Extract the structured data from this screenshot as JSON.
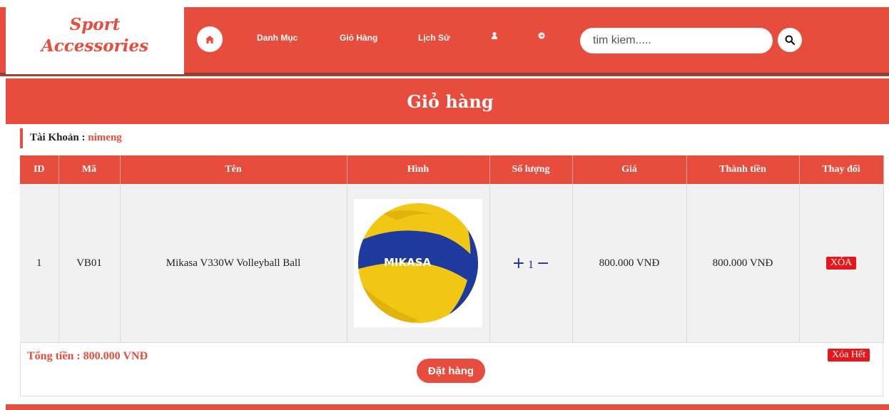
{
  "brand": {
    "line1": "Sport",
    "line2": "Accessories",
    "color": "#e74c3c"
  },
  "nav": {
    "home_icon": "home-icon",
    "items": [
      {
        "label": "Danh Mục"
      },
      {
        "label": "Giỏ Hàng"
      },
      {
        "label": "Lịch Sử"
      }
    ],
    "user_icon": "user-icon",
    "logout_icon": "sign-out-icon"
  },
  "search": {
    "placeholder": "tim kiem.....",
    "icon": "search-icon"
  },
  "page_title": "Giỏ hàng",
  "account": {
    "label": "Tài Khoản :",
    "username": "nimeng"
  },
  "table": {
    "headers": [
      "ID",
      "Mã",
      "Tên",
      "Hình",
      "Số lượng",
      "Giá",
      "Thành tiền",
      "Thay đổi"
    ],
    "rows": [
      {
        "id": "1",
        "code": "VB01",
        "name": "Mikasa V330W Volleyball Ball",
        "image": "volleyball-image",
        "qty_plus": "+",
        "quantity": "1",
        "qty_minus": "−",
        "price": "800.000 VNĐ",
        "subtotal": "800.000 VNĐ",
        "delete_label": "XÓA"
      }
    ]
  },
  "summary": {
    "total": "Tổng tiền : 800.000 VNĐ"
  },
  "actions": {
    "order_label": "Đặt hàng",
    "clear_label": "Xóa Hết"
  },
  "colors": {
    "accent": "#e74c3c",
    "danger": "#e8161a",
    "qty": "#1a2a9b"
  }
}
